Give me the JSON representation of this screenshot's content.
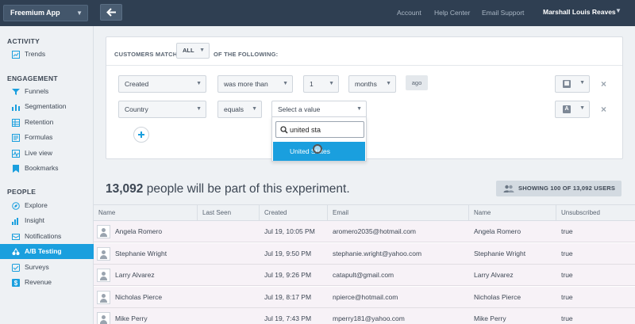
{
  "topbar": {
    "app_name": "Freemium App",
    "links": [
      "Account",
      "Help Center",
      "Email Support"
    ],
    "user_name": "Marshall Louis Reaves"
  },
  "sidebar": {
    "sections": [
      {
        "title": "ACTIVITY",
        "items": [
          {
            "label": "Trends",
            "icon": "trends-icon"
          }
        ]
      },
      {
        "title": "ENGAGEMENT",
        "items": [
          {
            "label": "Funnels",
            "icon": "funnel-icon"
          },
          {
            "label": "Segmentation",
            "icon": "segmentation-icon"
          },
          {
            "label": "Retention",
            "icon": "retention-icon"
          },
          {
            "label": "Formulas",
            "icon": "formulas-icon"
          },
          {
            "label": "Live view",
            "icon": "live-view-icon"
          },
          {
            "label": "Bookmarks",
            "icon": "bookmark-icon"
          }
        ]
      },
      {
        "title": "PEOPLE",
        "items": [
          {
            "label": "Explore",
            "icon": "explore-icon"
          },
          {
            "label": "Insight",
            "icon": "insight-icon"
          },
          {
            "label": "Notifications",
            "icon": "notifications-icon"
          },
          {
            "label": "A/B Testing",
            "icon": "ab-testing-icon",
            "active": true
          },
          {
            "label": "Surveys",
            "icon": "surveys-icon"
          },
          {
            "label": "Revenue",
            "icon": "revenue-icon"
          }
        ]
      }
    ]
  },
  "filter": {
    "match_prefix": "CUSTOMERS MATCH",
    "match_value": "ALL",
    "match_suffix": "OF THE FOLLOWING:",
    "row1": {
      "property": "Created",
      "operator": "was more than",
      "amount": "1",
      "unit": "months",
      "suffix": "ago"
    },
    "row2": {
      "property": "Country",
      "operator": "equals",
      "value_placeholder": "Select a value"
    },
    "dropdown": {
      "search_value": "united sta",
      "option": "United States"
    }
  },
  "summary": {
    "count": "13,092",
    "text": "people will be part of this experiment.",
    "showing_label": "SHOWING 100 OF 13,092 USERS"
  },
  "table": {
    "columns": [
      "Name",
      "Last Seen",
      "Created",
      "Email",
      "Name",
      "Unsubscribed"
    ],
    "rows": [
      {
        "name": "Angela Romero",
        "last_seen": "",
        "created": "Jul 19, 10:05 PM",
        "email": "aromero2035@hotmail.com",
        "name2": "Angela Romero",
        "unsubscribed": "true"
      },
      {
        "name": "Stephanie Wright",
        "last_seen": "",
        "created": "Jul 19, 9:50 PM",
        "email": "stephanie.wright@yahoo.com",
        "name2": "Stephanie Wright",
        "unsubscribed": "true"
      },
      {
        "name": "Larry Alvarez",
        "last_seen": "",
        "created": "Jul 19, 9:26 PM",
        "email": "catapult@gmail.com",
        "name2": "Larry Alvarez",
        "unsubscribed": "true"
      },
      {
        "name": "Nicholas Pierce",
        "last_seen": "",
        "created": "Jul 19, 8:17 PM",
        "email": "npierce@hotmail.com",
        "name2": "Nicholas Pierce",
        "unsubscribed": "true"
      },
      {
        "name": "Mike Perry",
        "last_seen": "",
        "created": "Jul 19, 7:43 PM",
        "email": "mperry181@yahoo.com",
        "name2": "Mike Perry",
        "unsubscribed": "true"
      }
    ]
  },
  "colors": {
    "topbar": "#2f3f52",
    "accent": "#1a9fde",
    "row_bg": "#f7f2f7"
  }
}
